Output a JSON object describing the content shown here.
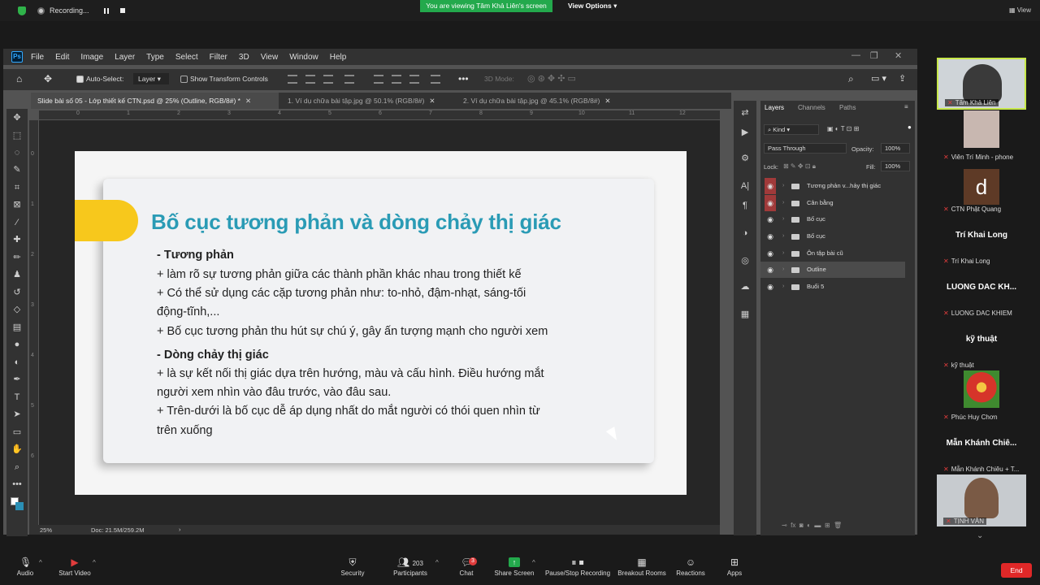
{
  "zoom_top": {
    "recording_label": "Recording...",
    "viewing_banner": "You are viewing Tâm Khả Liên's screen",
    "view_options": "View Options",
    "view_label": "View"
  },
  "photoshop": {
    "menu": [
      "File",
      "Edit",
      "Image",
      "Layer",
      "Type",
      "Select",
      "Filter",
      "3D",
      "View",
      "Window",
      "Help"
    ],
    "options": {
      "auto_select_label": "Auto-Select:",
      "layer_select": "Layer",
      "show_transform_label": "Show Transform Controls",
      "mode_3d": "3D Mode:"
    },
    "tabs": [
      {
        "label": "Slide bài số 05 - Lớp thiết kế CTN.psd @ 25% (Outline, RGB/8#) *",
        "active": true
      },
      {
        "label": "1. Ví dụ chữa bài tập.jpg @ 50.1% (RGB/8#)",
        "active": false
      },
      {
        "label": "2. Ví dụ chữa bài tập.jpg @ 45.1% (RGB/8#)",
        "active": false
      }
    ],
    "ruler_h": [
      "0",
      "1",
      "2",
      "3",
      "4",
      "5",
      "6",
      "7",
      "8",
      "9",
      "10",
      "11",
      "12"
    ],
    "ruler_v": [
      "0",
      "1",
      "2",
      "3",
      "4",
      "5",
      "6"
    ],
    "status": {
      "zoom": "25%",
      "doc": "Doc: 21.5M/259.2M"
    },
    "slide": {
      "title": "Bố cục tương phản và dòng chảy thị giác",
      "lines": [
        {
          "text": "- Tương phản",
          "bold": true
        },
        {
          "text": "+ làm rõ sự tương phản giữa các thành phần khác nhau trong thiết kế",
          "bold": false
        },
        {
          "text": "+ Có thể sử dụng các cặp tương phản như: to-nhỏ, đậm-nhạt, sáng-tối",
          "bold": false
        },
        {
          "text": "động-tĩnh,...",
          "bold": false
        },
        {
          "text": "+ Bố cục tương phản thu hút sự chú ý, gây ấn tượng mạnh cho người xem",
          "bold": false
        },
        {
          "text": "- Dòng chảy thị giác",
          "bold": true
        },
        {
          "text": "+ là sự kết nối thị giác dựa trên hướng, màu và cấu hình. Điều hướng mắt",
          "bold": false
        },
        {
          "text": "người xem nhìn vào đâu trước, vào đâu sau.",
          "bold": false
        },
        {
          "text": "+ Trên-dưới là bố cục dễ áp dụng nhất do mắt người có thói quen nhìn từ",
          "bold": false
        },
        {
          "text": "trên xuống",
          "bold": false
        }
      ],
      "colors": {
        "title": "#2a9bb5",
        "accent": "#f7c81c"
      }
    },
    "layers_panel": {
      "tabs": [
        "Layers",
        "Channels",
        "Paths"
      ],
      "kind": "Kind",
      "blend_mode": "Pass Through",
      "opacity_label": "Opacity:",
      "opacity": "100%",
      "lock_label": "Lock:",
      "fill_label": "Fill:",
      "fill": "100%",
      "layers": [
        {
          "name": "Tương phản v...hảy thị giác",
          "eye_red": true,
          "selected": false
        },
        {
          "name": "Cân bằng",
          "eye_red": true,
          "selected": false
        },
        {
          "name": "Bố cục",
          "eye_red": false,
          "selected": false
        },
        {
          "name": "Bố cục",
          "eye_red": false,
          "selected": false
        },
        {
          "name": "Ôn tập bài cũ",
          "eye_red": false,
          "selected": false
        },
        {
          "name": "Outline",
          "eye_red": false,
          "selected": true
        },
        {
          "name": "Buổi 5",
          "eye_red": false,
          "selected": false
        }
      ]
    }
  },
  "participants": [
    {
      "name": "Tâm Khả Liên",
      "big": "",
      "type": "video"
    },
    {
      "name": "Viên Trí Minh - phone",
      "big": "",
      "type": "video"
    },
    {
      "name": "CTN Phật Quang",
      "big": "d",
      "type": "letter"
    },
    {
      "name": "Trí Khai Long",
      "big": "Trí Khai Long",
      "type": "text"
    },
    {
      "name": "LUONG DAC KHIEM",
      "big": "LUONG DAC KH...",
      "type": "text"
    },
    {
      "name": "kỹ thuật",
      "big": "kỹ thuật",
      "type": "text"
    },
    {
      "name": "Phúc Huy Chơn",
      "big": "",
      "type": "flower"
    },
    {
      "name": "Mẫn Khánh Chiêu + T...",
      "big": "Mẫn Khánh Chiê...",
      "type": "text"
    },
    {
      "name": "TỊNH VÂN",
      "big": "",
      "type": "video"
    }
  ],
  "bottom_bar": {
    "audio": "Audio",
    "start_video": "Start Video",
    "security": "Security",
    "participants": "Participants",
    "participants_count": "203",
    "chat": "Chat",
    "chat_badge": "3",
    "share_screen": "Share Screen",
    "pause_recording": "Pause/Stop Recording",
    "breakout": "Breakout Rooms",
    "reactions": "Reactions",
    "apps": "Apps",
    "end": "End"
  }
}
